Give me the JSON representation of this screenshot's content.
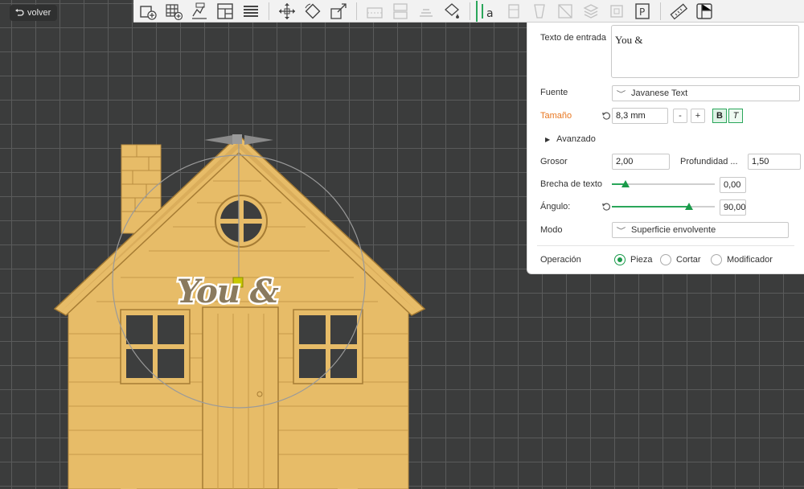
{
  "back_button": {
    "label": "volver"
  },
  "toolbar": {
    "tools": [
      {
        "name": "add-part-icon",
        "disabled": false
      },
      {
        "name": "grid-add-icon",
        "disabled": false
      },
      {
        "name": "text-emboss-icon",
        "disabled": false
      },
      {
        "name": "layout-icon",
        "disabled": false
      },
      {
        "name": "list-icon",
        "disabled": false
      },
      {
        "name": "move-icon",
        "disabled": false
      },
      {
        "name": "rotate-icon",
        "disabled": false
      },
      {
        "name": "scale-icon",
        "disabled": false
      },
      {
        "name": "cut-icon",
        "disabled": true
      },
      {
        "name": "split-icon",
        "disabled": true
      },
      {
        "name": "arrange-icon",
        "disabled": true
      },
      {
        "name": "paint-icon",
        "disabled": false
      },
      {
        "name": "text-tool-icon",
        "disabled": false,
        "active": true
      },
      {
        "name": "support-icon",
        "disabled": true
      },
      {
        "name": "seam-icon",
        "disabled": true
      },
      {
        "name": "mesh-icon",
        "disabled": true
      },
      {
        "name": "layers-icon",
        "disabled": true
      },
      {
        "name": "hollow-icon",
        "disabled": true
      },
      {
        "name": "placement-icon",
        "disabled": false
      },
      {
        "name": "measure-icon",
        "disabled": false
      },
      {
        "name": "assembly-icon",
        "disabled": false
      }
    ]
  },
  "panel": {
    "input_label": "Texto de entrada",
    "input_value": "You &",
    "font_label": "Fuente",
    "font_value": "Javanese Text",
    "size_label": "Tamaño",
    "size_value": "8,3 mm",
    "minus_label": "-",
    "plus_label": "+",
    "bold_label": "B",
    "italic_label": "T",
    "advanced_label": "Avanzado",
    "thickness_label": "Grosor",
    "thickness_value": "2,00",
    "depth_label": "Profundidad ...",
    "depth_value": "1,50",
    "gap_label": "Brecha de texto",
    "gap_value": "0,00",
    "gap_fraction": 0.13,
    "angle_label": "Ángulo:",
    "angle_value": "90,00",
    "angle_fraction": 0.75,
    "mode_label": "Modo",
    "mode_value": "Superficie envolvente",
    "operation_label": "Operación",
    "operations": [
      {
        "label": "Pieza",
        "selected": true
      },
      {
        "label": "Cortar",
        "selected": false
      },
      {
        "label": "Modificador",
        "selected": false
      }
    ]
  },
  "scene": {
    "embossed_text": "You &",
    "colors": {
      "house": "#e7bc68",
      "house_shadow": "#c79a4a",
      "text": "#8a7a5e",
      "text_outline": "#ffffff",
      "accent": "#2aa65a",
      "gizmo": "#c8c800"
    }
  }
}
